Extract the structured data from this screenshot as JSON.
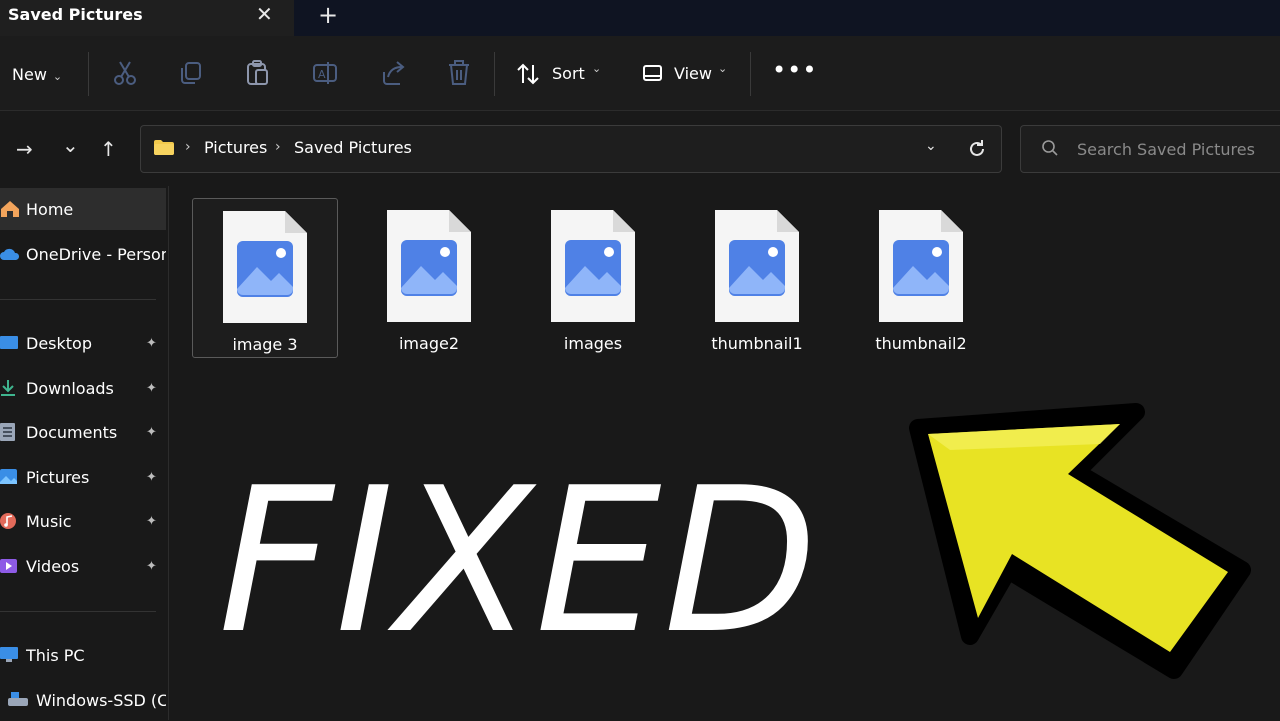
{
  "tab": {
    "title": "Saved Pictures",
    "close": "✕",
    "new": "+"
  },
  "toolbar": {
    "new_label": "New",
    "sort_label": "Sort",
    "view_label": "View",
    "more": "•••",
    "icons": [
      "cut-icon",
      "copy-icon",
      "paste-icon",
      "rename-icon",
      "share-icon",
      "delete-icon"
    ]
  },
  "nav": {
    "forward": "→",
    "recent": "⌄",
    "up": "↑"
  },
  "breadcrumb": [
    "Pictures",
    "Saved Pictures"
  ],
  "search": {
    "placeholder": "Search Saved Pictures"
  },
  "sidebar": {
    "items": [
      {
        "label": "Home",
        "icon": "home-icon",
        "pinned": false
      },
      {
        "label": "OneDrive - Persona",
        "icon": "cloud-icon",
        "pinned": false
      },
      {
        "label": "Desktop",
        "icon": "desktop-icon",
        "pinned": true
      },
      {
        "label": "Downloads",
        "icon": "download-icon",
        "pinned": true
      },
      {
        "label": "Documents",
        "icon": "documents-icon",
        "pinned": true
      },
      {
        "label": "Pictures",
        "icon": "pictures-icon",
        "pinned": true
      },
      {
        "label": "Music",
        "icon": "music-icon",
        "pinned": true
      },
      {
        "label": "Videos",
        "icon": "videos-icon",
        "pinned": true
      },
      {
        "label": "This PC",
        "icon": "pc-icon",
        "pinned": false
      },
      {
        "label": "Windows-SSD (C:",
        "icon": "drive-icon",
        "pinned": false
      }
    ],
    "pin_glyph": "📌"
  },
  "files": [
    {
      "name": "image 3",
      "selected": true
    },
    {
      "name": "image2",
      "selected": false
    },
    {
      "name": "images",
      "selected": false
    },
    {
      "name": "thumbnail1",
      "selected": false
    },
    {
      "name": "thumbnail2",
      "selected": false
    }
  ],
  "overlay": {
    "text": "FIXED",
    "arrow_color": "#e8e323"
  },
  "colors": {
    "accent": "#3a8ee6",
    "folder": "#f2c94c",
    "background": "#191919"
  }
}
